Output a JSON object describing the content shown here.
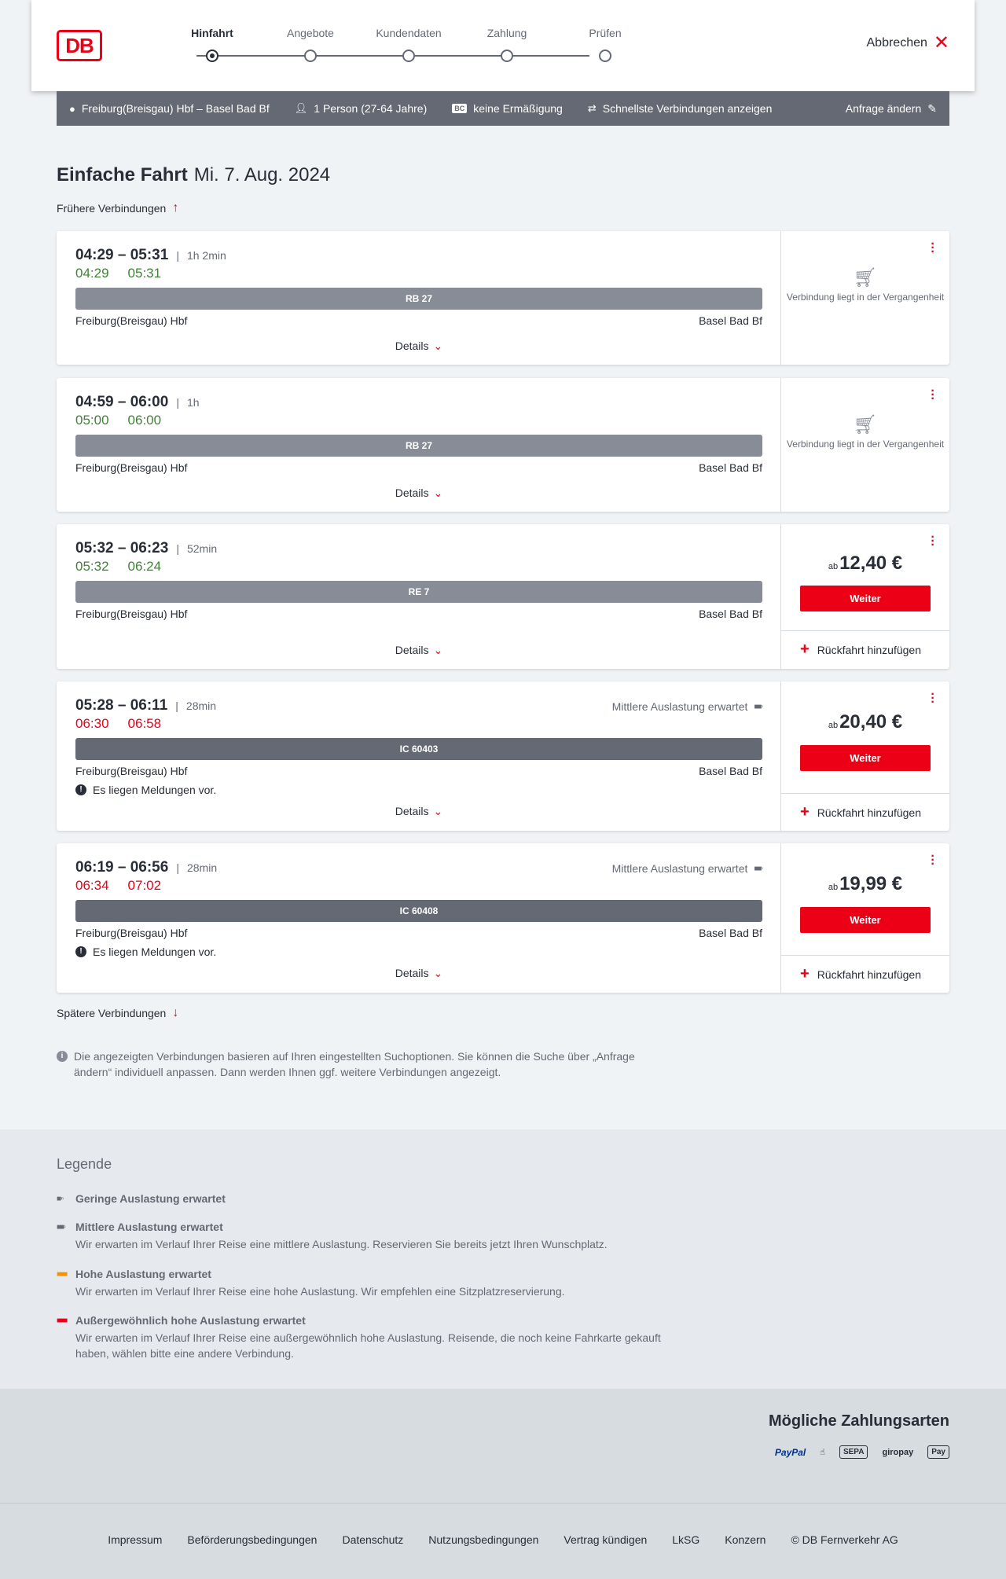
{
  "header": {
    "logo": "DB",
    "steps": [
      "Hinfahrt",
      "Angebote",
      "Kundendaten",
      "Zahlung",
      "Prüfen"
    ],
    "cancel": "Abbrechen"
  },
  "summary": {
    "route": "Freiburg(Breisgau) Hbf – Basel Bad Bf",
    "passengers": "1 Person (27-64 Jahre)",
    "bc_icon": "BC",
    "discount": "keine Ermäßigung",
    "option": "Schnellste Verbindungen anzeigen",
    "change": "Anfrage ändern"
  },
  "title": {
    "main": "Einfache Fahrt",
    "date": "Mi. 7. Aug. 2024"
  },
  "earlier": "Frühere Verbindungen",
  "later": "Spätere Verbindungen",
  "connections": [
    {
      "time": "04:29 – 05:31",
      "duration": "1h 2min",
      "rt_dep": "04:29",
      "rt_arr": "05:31",
      "rt_status": "green",
      "train": "RB 27",
      "from": "Freiburg(Breisgau) Hbf",
      "to": "Basel Bad Bf",
      "details": "Details",
      "past": "Verbindung liegt in der Vergangenheit"
    },
    {
      "time": "04:59 – 06:00",
      "duration": "1h",
      "rt_dep": "05:00",
      "rt_arr": "06:00",
      "rt_status": "green",
      "train": "RB 27",
      "from": "Freiburg(Breisgau) Hbf",
      "to": "Basel Bad Bf",
      "details": "Details",
      "past": "Verbindung liegt in der Vergangenheit"
    },
    {
      "time": "05:32 – 06:23",
      "duration": "52min",
      "rt_dep": "05:32",
      "rt_arr": "06:24",
      "rt_status": "green",
      "train": "RE 7",
      "from": "Freiburg(Breisgau) Hbf",
      "to": "Basel Bad Bf",
      "details": "Details",
      "price_prefix": "ab",
      "price": "12,40 €",
      "button": "Weiter",
      "return": "Rückfahrt hinzufügen"
    },
    {
      "time": "05:28 – 06:11",
      "duration": "28min",
      "rt_dep": "06:30",
      "rt_arr": "06:58",
      "rt_status": "red",
      "train": "IC 60403",
      "from": "Freiburg(Breisgau) Hbf",
      "to": "Basel Bad Bf",
      "notice": "Es liegen Meldungen vor.",
      "occupancy": "Mittlere Auslastung erwartet",
      "details": "Details",
      "price_prefix": "ab",
      "price": "20,40 €",
      "button": "Weiter",
      "return": "Rückfahrt hinzufügen"
    },
    {
      "time": "06:19 – 06:56",
      "duration": "28min",
      "rt_dep": "06:34",
      "rt_arr": "07:02",
      "rt_status": "red",
      "train": "IC 60408",
      "from": "Freiburg(Breisgau) Hbf",
      "to": "Basel Bad Bf",
      "notice": "Es liegen Meldungen vor.",
      "occupancy": "Mittlere Auslastung erwartet",
      "details": "Details",
      "price_prefix": "ab",
      "price": "19,99 €",
      "button": "Weiter",
      "return": "Rückfahrt hinzufügen"
    }
  ],
  "info": "Die angezeigten Verbindungen basieren auf Ihren eingestellten Suchoptionen. Sie können die Suche über „Anfrage ändern“ individuell anpassen. Dann werden Ihnen ggf. weitere Verbindungen angezeigt.",
  "legend": {
    "title": "Legende",
    "items": [
      {
        "title": "Geringe Auslastung erwartet",
        "desc": ""
      },
      {
        "title": "Mittlere Auslastung erwartet",
        "desc": "Wir erwarten im Verlauf Ihrer Reise eine mittlere Auslastung. Reservieren Sie bereits jetzt Ihren Wunschplatz."
      },
      {
        "title": "Hohe Auslastung erwartet",
        "desc": "Wir erwarten im Verlauf Ihrer Reise eine hohe Auslastung. Wir empfehlen eine Sitzplatzreservierung."
      },
      {
        "title": "Außergewöhnlich hohe Auslastung erwartet",
        "desc": "Wir erwarten im Verlauf Ihrer Reise eine außergewöhnlich hohe Auslastung. Reisende, die noch keine Fahrkarte gekauft haben, wählen bitte eine andere Verbindung."
      }
    ]
  },
  "payments": {
    "title": "Mögliche Zahlungsarten",
    "paypal": "PayPal",
    "sepa": "SEPA",
    "giropay": "giropay",
    "applepay": "Pay"
  },
  "footer": [
    "Impressum",
    "Beförderungsbedingungen",
    "Datenschutz",
    "Nutzungsbedingungen",
    "Vertrag kündigen",
    "LkSG",
    "Konzern",
    "© DB Fernverkehr AG"
  ],
  "colors": {
    "db_red": "#ec0016",
    "realtime_green": "#408335",
    "summary_bg": "#646973"
  }
}
